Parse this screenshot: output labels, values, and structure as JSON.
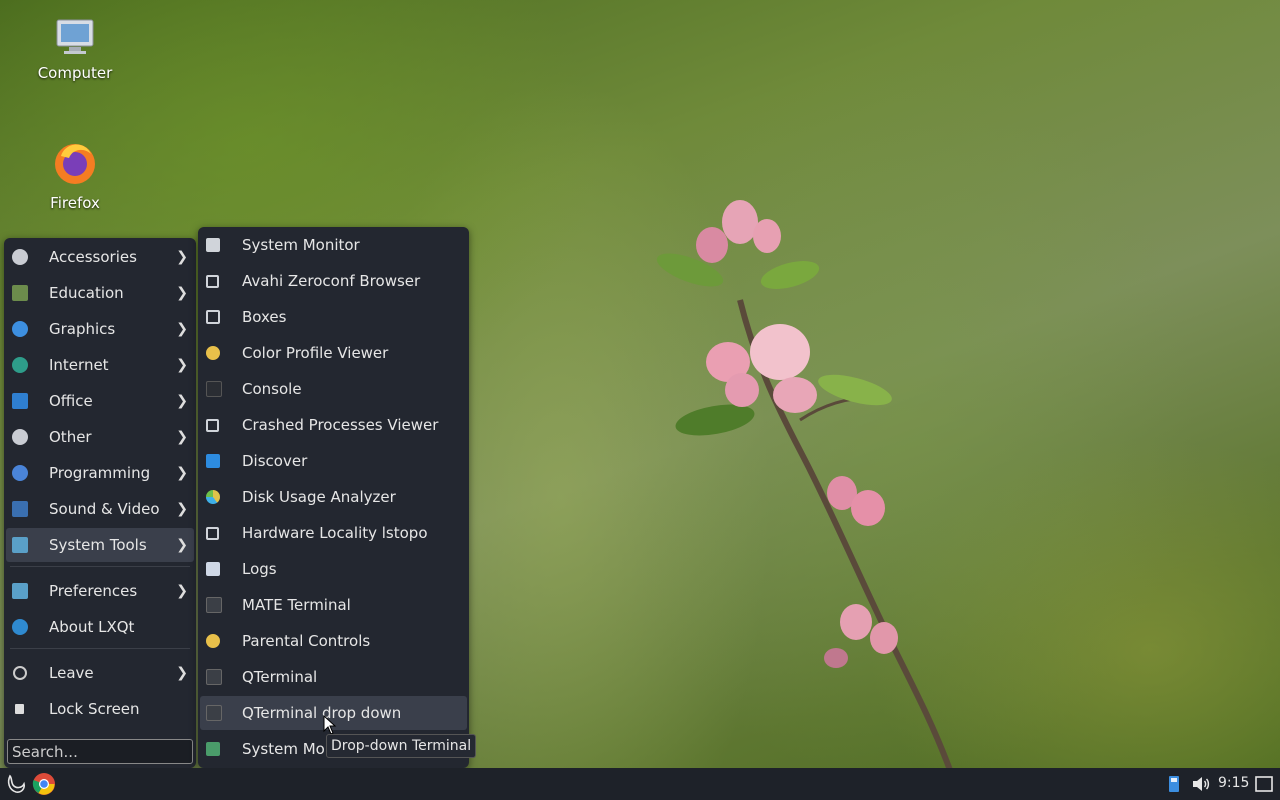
{
  "desktop": {
    "icons": [
      {
        "label": "Computer",
        "icon": "computer-icon"
      },
      {
        "label": "Firefox",
        "icon": "firefox-icon"
      }
    ]
  },
  "main_menu": {
    "items": [
      {
        "label": "Accessories",
        "icon": "accessories-icon"
      },
      {
        "label": "Education",
        "icon": "education-icon"
      },
      {
        "label": "Graphics",
        "icon": "graphics-icon"
      },
      {
        "label": "Internet",
        "icon": "internet-icon"
      },
      {
        "label": "Office",
        "icon": "office-icon"
      },
      {
        "label": "Other",
        "icon": "other-icon"
      },
      {
        "label": "Programming",
        "icon": "programming-icon"
      },
      {
        "label": "Sound & Video",
        "icon": "sound-video-icon"
      },
      {
        "label": "System Tools",
        "icon": "system-tools-icon",
        "active": true
      },
      {
        "label": "Preferences",
        "icon": "preferences-icon"
      },
      {
        "label": "About LXQt",
        "icon": "about-icon"
      },
      {
        "label": "Leave",
        "icon": "power-icon"
      },
      {
        "label": "Lock Screen",
        "icon": "lock-icon"
      }
    ],
    "search_placeholder": "Search..."
  },
  "submenu": {
    "items": [
      {
        "label": "System Monitor",
        "icon": "system-monitor-icon"
      },
      {
        "label": "Avahi Zeroconf Browser",
        "icon": "avahi-icon"
      },
      {
        "label": "Boxes",
        "icon": "boxes-icon"
      },
      {
        "label": "Color Profile Viewer",
        "icon": "color-profile-icon"
      },
      {
        "label": "Console",
        "icon": "console-icon"
      },
      {
        "label": "Crashed Processes Viewer",
        "icon": "crash-viewer-icon"
      },
      {
        "label": "Discover",
        "icon": "discover-icon"
      },
      {
        "label": "Disk Usage Analyzer",
        "icon": "disk-usage-icon"
      },
      {
        "label": "Hardware Locality lstopo",
        "icon": "lstopo-icon"
      },
      {
        "label": "Logs",
        "icon": "logs-icon"
      },
      {
        "label": "MATE Terminal",
        "icon": "terminal-icon"
      },
      {
        "label": "Parental Controls",
        "icon": "parental-controls-icon"
      },
      {
        "label": "QTerminal",
        "icon": "terminal-icon"
      },
      {
        "label": "QTerminal drop down",
        "icon": "terminal-icon",
        "hover": true
      },
      {
        "label": "System Mor",
        "icon": "system-monitor-icon"
      }
    ]
  },
  "tooltip": "Drop-down Terminal",
  "taskbar": {
    "clock": "9:15"
  },
  "colors": {
    "menu_bg": "#232730",
    "highlight": "#3a3f4b",
    "taskbar_bg": "#1e2229"
  }
}
